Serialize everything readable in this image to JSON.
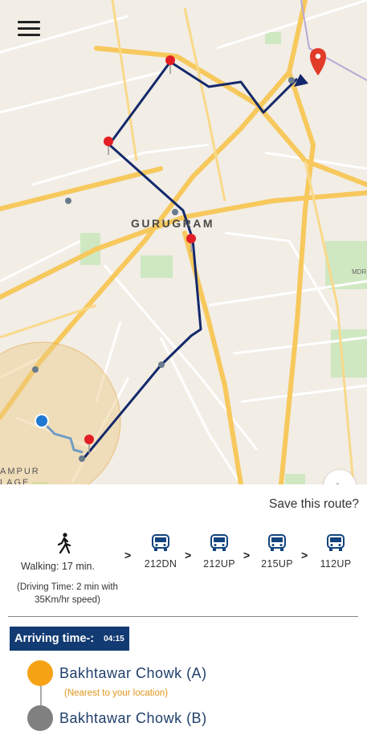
{
  "map": {
    "city_label": "GURUGRAM",
    "area_label_line1": "AMPUR",
    "area_label_line2": "LAGE",
    "road_label": "MDR",
    "route_color": "#14296b",
    "road_color": "#f7c85c"
  },
  "header": {
    "menu_icon": "hamburger-menu-icon"
  },
  "route": {
    "save_label": "Save this route?",
    "walking_text": "Walking: 17 min.",
    "driving_text": "(Driving Time: 2 min with 35Km/hr speed)",
    "buses": [
      {
        "code": "212DN"
      },
      {
        "code": "212UP"
      },
      {
        "code": "215UP"
      },
      {
        "code": "112UP"
      }
    ]
  },
  "arriving": {
    "label": "Arriving time-:",
    "time": "04:15"
  },
  "stops": [
    {
      "name": "Bakhtawar Chowk (A)",
      "note": "(Nearest to your location)",
      "color": "#f5a214"
    },
    {
      "name": "Bakhtawar Chowk (B)",
      "color": "#808080"
    }
  ]
}
